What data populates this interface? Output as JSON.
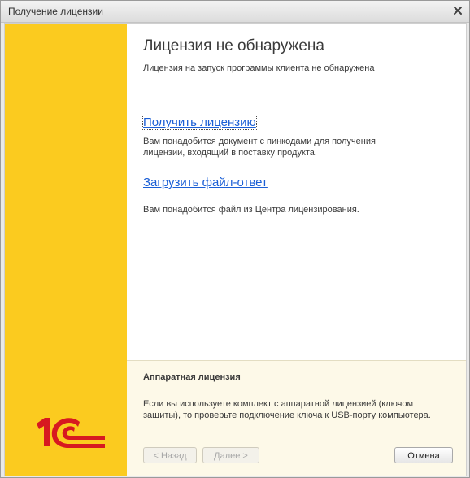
{
  "window": {
    "title": "Получение лицензии"
  },
  "main": {
    "title": "Лицензия не обнаружена",
    "subtitle": "Лицензия на запуск программы клиента не обнаружена",
    "get_license": {
      "link": "Получить лицензию",
      "desc": "Вам понадобится документ с пинкодами для получения лицензии, входящий в поставку продукта."
    },
    "load_response": {
      "link": "Загрузить файл-ответ",
      "desc": "Вам понадобится файл из Центра лицензирования."
    }
  },
  "hardware": {
    "title": "Аппаратная лицензия",
    "desc": "Если вы используете комплект с аппаратной лицензией (ключом защиты), то проверьте подключение ключа к USB-порту компьютера."
  },
  "buttons": {
    "back": "< Назад",
    "next": "Далее >",
    "cancel": "Отмена"
  },
  "colors": {
    "brand_yellow": "#fbcb1f",
    "brand_red": "#d71920",
    "link_blue": "#1b5fd6"
  },
  "icons": {
    "close": "close-icon",
    "logo": "1c-logo"
  }
}
